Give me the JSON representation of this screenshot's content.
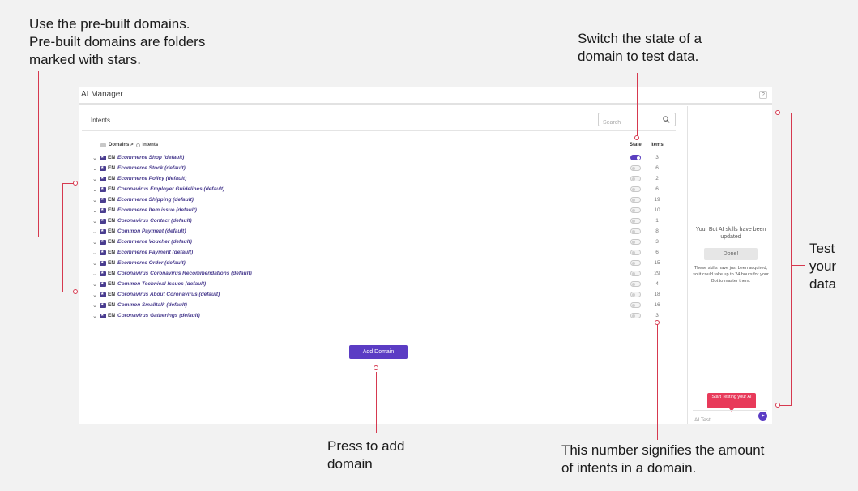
{
  "annotations": {
    "prebuilt": [
      "Use the pre-built domains.",
      "Pre-built domains are folders",
      "marked with stars."
    ],
    "switch": [
      "Switch the state of a",
      "domain to test data."
    ],
    "test": [
      "Test",
      "your",
      "data"
    ],
    "press": [
      "Press to add",
      "domain"
    ],
    "number": [
      "This number signifies the amount",
      "of intents in a domain."
    ]
  },
  "window": {
    "title": "AI Manager",
    "help": "?"
  },
  "main": {
    "title": "Intents",
    "search_placeholder": "Search",
    "breadcrumb_domains": "Domains >",
    "breadcrumb_intents": "Intents",
    "col_state": "State",
    "col_items": "Items",
    "add_domain": "Add Domain"
  },
  "domains": [
    {
      "lang": "EN",
      "name": "Ecommerce Shop (default)",
      "state": true,
      "items": "3"
    },
    {
      "lang": "EN",
      "name": "Ecommerce Stock (default)",
      "state": false,
      "items": "6"
    },
    {
      "lang": "EN",
      "name": "Ecommerce Policy (default)",
      "state": false,
      "items": "2"
    },
    {
      "lang": "EN",
      "name": "Coronavirus Employer Guidelines (default)",
      "state": false,
      "items": "6"
    },
    {
      "lang": "EN",
      "name": "Ecommerce Shipping (default)",
      "state": false,
      "items": "19"
    },
    {
      "lang": "EN",
      "name": "Ecommerce Item issue (default)",
      "state": false,
      "items": "10"
    },
    {
      "lang": "EN",
      "name": "Coronavirus Contact (default)",
      "state": false,
      "items": "1"
    },
    {
      "lang": "EN",
      "name": "Common Payment (default)",
      "state": false,
      "items": "8"
    },
    {
      "lang": "EN",
      "name": "Ecommerce Voucher (default)",
      "state": false,
      "items": "3"
    },
    {
      "lang": "EN",
      "name": "Ecommerce Payment (default)",
      "state": false,
      "items": "6"
    },
    {
      "lang": "EN",
      "name": "Ecommerce Order (default)",
      "state": false,
      "items": "15"
    },
    {
      "lang": "EN",
      "name": "Coronavirus Coronavirus Recommendations (default)",
      "state": false,
      "items": "29"
    },
    {
      "lang": "EN",
      "name": "Common Technical Issues (default)",
      "state": false,
      "items": "4"
    },
    {
      "lang": "EN",
      "name": "Coronavirus About Coronavirus (default)",
      "state": false,
      "items": "18"
    },
    {
      "lang": "EN",
      "name": "Common Smalltalk (default)",
      "state": false,
      "items": "16"
    },
    {
      "lang": "EN",
      "name": "Coronavirus Gatherings (default)",
      "state": false,
      "items": "3"
    }
  ],
  "sidebar": {
    "title": "Your Bot AI skills have been updated",
    "done": "Done!",
    "desc": "These skills have just been acquired, so it could take up to 24 hours for your Bot to master them.",
    "tooltip": "Start Testing your AI",
    "test_placeholder": "AI Test"
  },
  "colors": {
    "accent": "#5b3cc4",
    "domain_text": "#4a3d8f",
    "annotation_line": "#d6394f",
    "tooltip": "#e83a5a"
  }
}
